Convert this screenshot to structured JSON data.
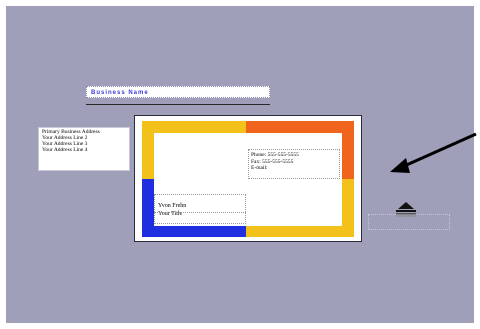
{
  "business_name": "Business Name",
  "address": {
    "lines": [
      "Primary Business Address",
      "Your Address Line 2",
      "Your Address Line 3",
      "Your Address Line 4"
    ]
  },
  "contact": {
    "phone": "Phone: 555-555-5555",
    "fax": "Fax: 555-555-5555",
    "email": "E-mail:"
  },
  "person": {
    "name": "Yvon Frehn",
    "title": "Your Title"
  },
  "icons": {
    "pointer_arrow": "arrow-icon",
    "frame_shape": "frame-shape-icon"
  },
  "colors": {
    "canvas": "#9f9fb9",
    "frame_yellow": "#f2c21b",
    "frame_orange": "#f0641e",
    "frame_blue": "#1f2fe0",
    "business_name_text": "#3b3bd9"
  }
}
